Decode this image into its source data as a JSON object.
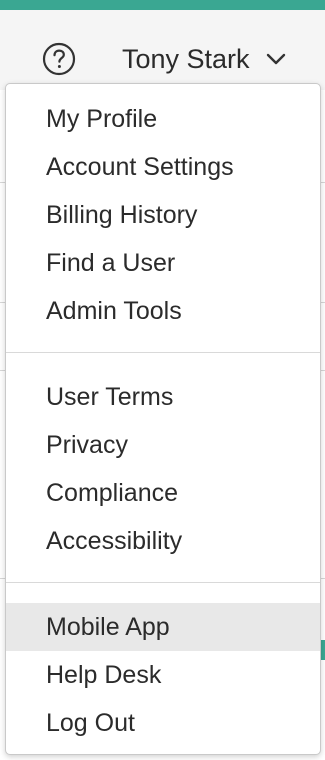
{
  "header": {
    "user_name": "Tony Stark",
    "help_icon": "help-circle-icon",
    "chevron_icon": "chevron-down-icon"
  },
  "colors": {
    "accent": "#3aa792",
    "header_bg": "#f5f5f5",
    "highlight_bg": "#e8e8e8"
  },
  "menu": {
    "sections": [
      {
        "items": [
          {
            "label": "My Profile"
          },
          {
            "label": "Account Settings"
          },
          {
            "label": "Billing History"
          },
          {
            "label": "Find a User"
          },
          {
            "label": "Admin Tools"
          }
        ]
      },
      {
        "items": [
          {
            "label": "User Terms"
          },
          {
            "label": "Privacy"
          },
          {
            "label": "Compliance"
          },
          {
            "label": "Accessibility"
          }
        ]
      },
      {
        "items": [
          {
            "label": "Mobile App",
            "highlighted": true
          },
          {
            "label": "Help Desk"
          },
          {
            "label": "Log Out"
          }
        ]
      }
    ]
  }
}
